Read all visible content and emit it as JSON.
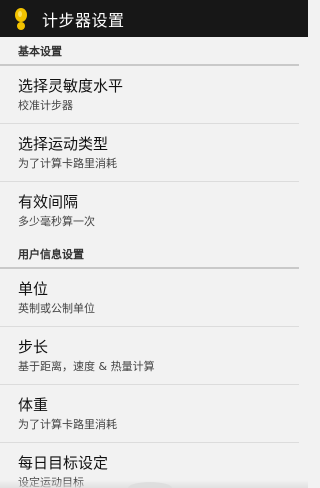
{
  "action_bar": {
    "title": "计步器设置",
    "icon": "footprint-icon"
  },
  "colors": {
    "action_bar_bg": "#171717",
    "background": "#f2f2f2",
    "icon_yellow": "#f2c200"
  },
  "sections": [
    {
      "header": "基本设置",
      "items": [
        {
          "title": "选择灵敏度水平",
          "summary": "校准计步器"
        },
        {
          "title": "选择运动类型",
          "summary": "为了计算卡路里消耗"
        },
        {
          "title": "有效间隔",
          "summary": "多少毫秒算一次"
        }
      ]
    },
    {
      "header": "用户信息设置",
      "items": [
        {
          "title": "单位",
          "summary": "英制或公制单位"
        },
        {
          "title": "步长",
          "summary": "基于距离，速度 & 热量计算"
        },
        {
          "title": "体重",
          "summary": "为了计算卡路里消耗"
        },
        {
          "title": "每日目标设定",
          "summary": "设定运动目标"
        }
      ]
    }
  ]
}
